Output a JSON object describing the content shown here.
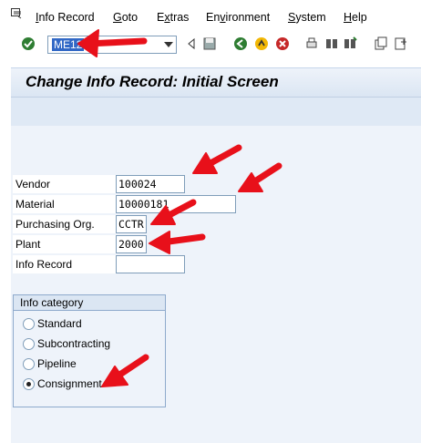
{
  "menubar": {
    "items": [
      {
        "label": "Info Record",
        "key": "I"
      },
      {
        "label": "Goto",
        "key": "G"
      },
      {
        "label": "Extras",
        "key": "x"
      },
      {
        "label": "Environment",
        "key": "v"
      },
      {
        "label": "System",
        "key": "S"
      },
      {
        "label": "Help",
        "key": "H"
      }
    ]
  },
  "toolbar": {
    "command_value": "ME12",
    "icons": [
      "enter-icon",
      "back-arrow-icon",
      "save-icon",
      "back-icon",
      "exit-icon",
      "cancel-icon",
      "print-icon",
      "find-icon",
      "find-next-icon",
      "create-session-icon",
      "shortcut-icon"
    ]
  },
  "title": "Change Info Record: Initial Screen",
  "form": {
    "vendor": {
      "label": "Vendor",
      "value": "100024"
    },
    "material": {
      "label": "Material",
      "value": "10000181"
    },
    "purch_org": {
      "label": "Purchasing Org.",
      "value": "CCTR"
    },
    "plant": {
      "label": "Plant",
      "value": "2000"
    },
    "info_record": {
      "label": "Info Record",
      "value": ""
    }
  },
  "info_category": {
    "title": "Info category",
    "options": [
      {
        "label": "Standard",
        "selected": false
      },
      {
        "label": "Subcontracting",
        "selected": false
      },
      {
        "label": "Pipeline",
        "selected": false
      },
      {
        "label": "Consignment",
        "selected": true
      }
    ]
  },
  "colors": {
    "annotation_arrow": "#e8101a",
    "selection": "#3168c6"
  }
}
